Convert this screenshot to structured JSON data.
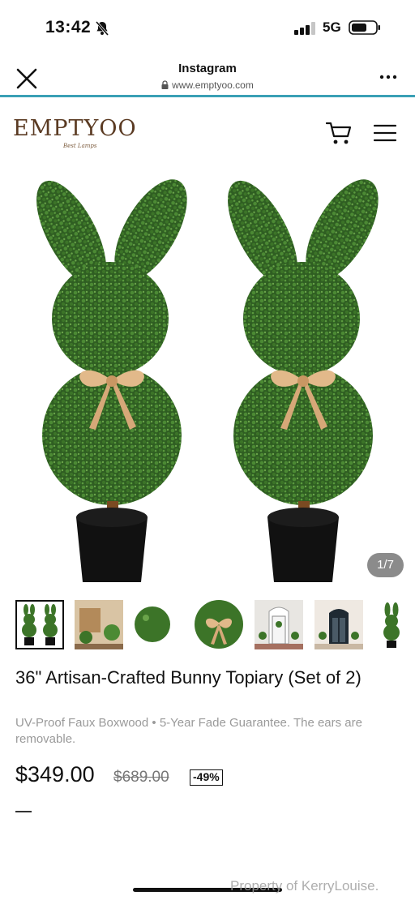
{
  "status_bar": {
    "time": "13:42",
    "network": "5G",
    "icons": [
      "bell-slash-icon",
      "signal-icon",
      "battery-icon"
    ]
  },
  "browser": {
    "app_name": "Instagram",
    "url": "www.emptyoo.com",
    "close_icon": "close-icon",
    "more_icon": "more-icon",
    "accent_color": "#3aa0b5"
  },
  "site": {
    "logo_text": "EMPTYOO",
    "logo_subtext": "Best Lamps",
    "cart_icon": "cart-icon",
    "menu_icon": "menu-icon"
  },
  "gallery": {
    "counter": "1/7",
    "thumbnails": [
      "thumb-bunny-pair",
      "thumb-porch",
      "thumb-closeup",
      "thumb-bow",
      "thumb-front-door",
      "thumb-entry",
      "thumb-single"
    ]
  },
  "product": {
    "title": "36\" Artisan-Crafted Bunny Topiary (Set of 2)",
    "description": "UV-Proof Faux Boxwood • 5-Year Fade Guarantee. The ears are removable.",
    "price": "$349.00",
    "original_price": "$689.00",
    "discount": "-49%",
    "dash": "—"
  },
  "watermark": "Property of KerryLouise."
}
